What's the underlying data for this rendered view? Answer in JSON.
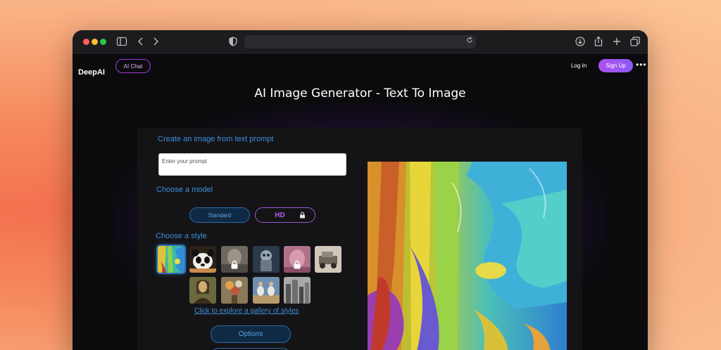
{
  "browser": {
    "address": ""
  },
  "header": {
    "logo": "DeepAI",
    "ai_chat_label": "AI Chat",
    "login_label": "Log In",
    "signup_label": "Sign Up",
    "more_label": "•••"
  },
  "page_title": "AI Image Generator - Text To Image",
  "form": {
    "create_label": "Create an image from text prompt",
    "prompt_placeholder": "Enter your prompt",
    "prompt_value": "",
    "model_label": "Choose a model",
    "model_standard": "Standard",
    "model_hd": "HD",
    "style_label": "Choose a style",
    "styles": [
      {
        "name": "abstract-painting",
        "selected": true,
        "locked": false
      },
      {
        "name": "panda",
        "selected": false,
        "locked": false
      },
      {
        "name": "blurred-portrait",
        "selected": false,
        "locked": true
      },
      {
        "name": "robot",
        "selected": false,
        "locked": false
      },
      {
        "name": "pink-portrait",
        "selected": false,
        "locked": true
      },
      {
        "name": "old-car-sketch",
        "selected": false,
        "locked": false
      },
      {
        "name": "mona-lisa",
        "selected": false,
        "locked": false
      },
      {
        "name": "floral-still-life",
        "selected": false,
        "locked": false
      },
      {
        "name": "dancers",
        "selected": false,
        "locked": false
      },
      {
        "name": "city-sketch",
        "selected": false,
        "locked": false
      }
    ],
    "gallery_link": "Click to explore a gallery of styles",
    "options_label": "Options"
  },
  "colors": {
    "accent_blue": "#3d8fd9",
    "accent_purple": "#a23ad8",
    "panel_bg": "#141417"
  }
}
